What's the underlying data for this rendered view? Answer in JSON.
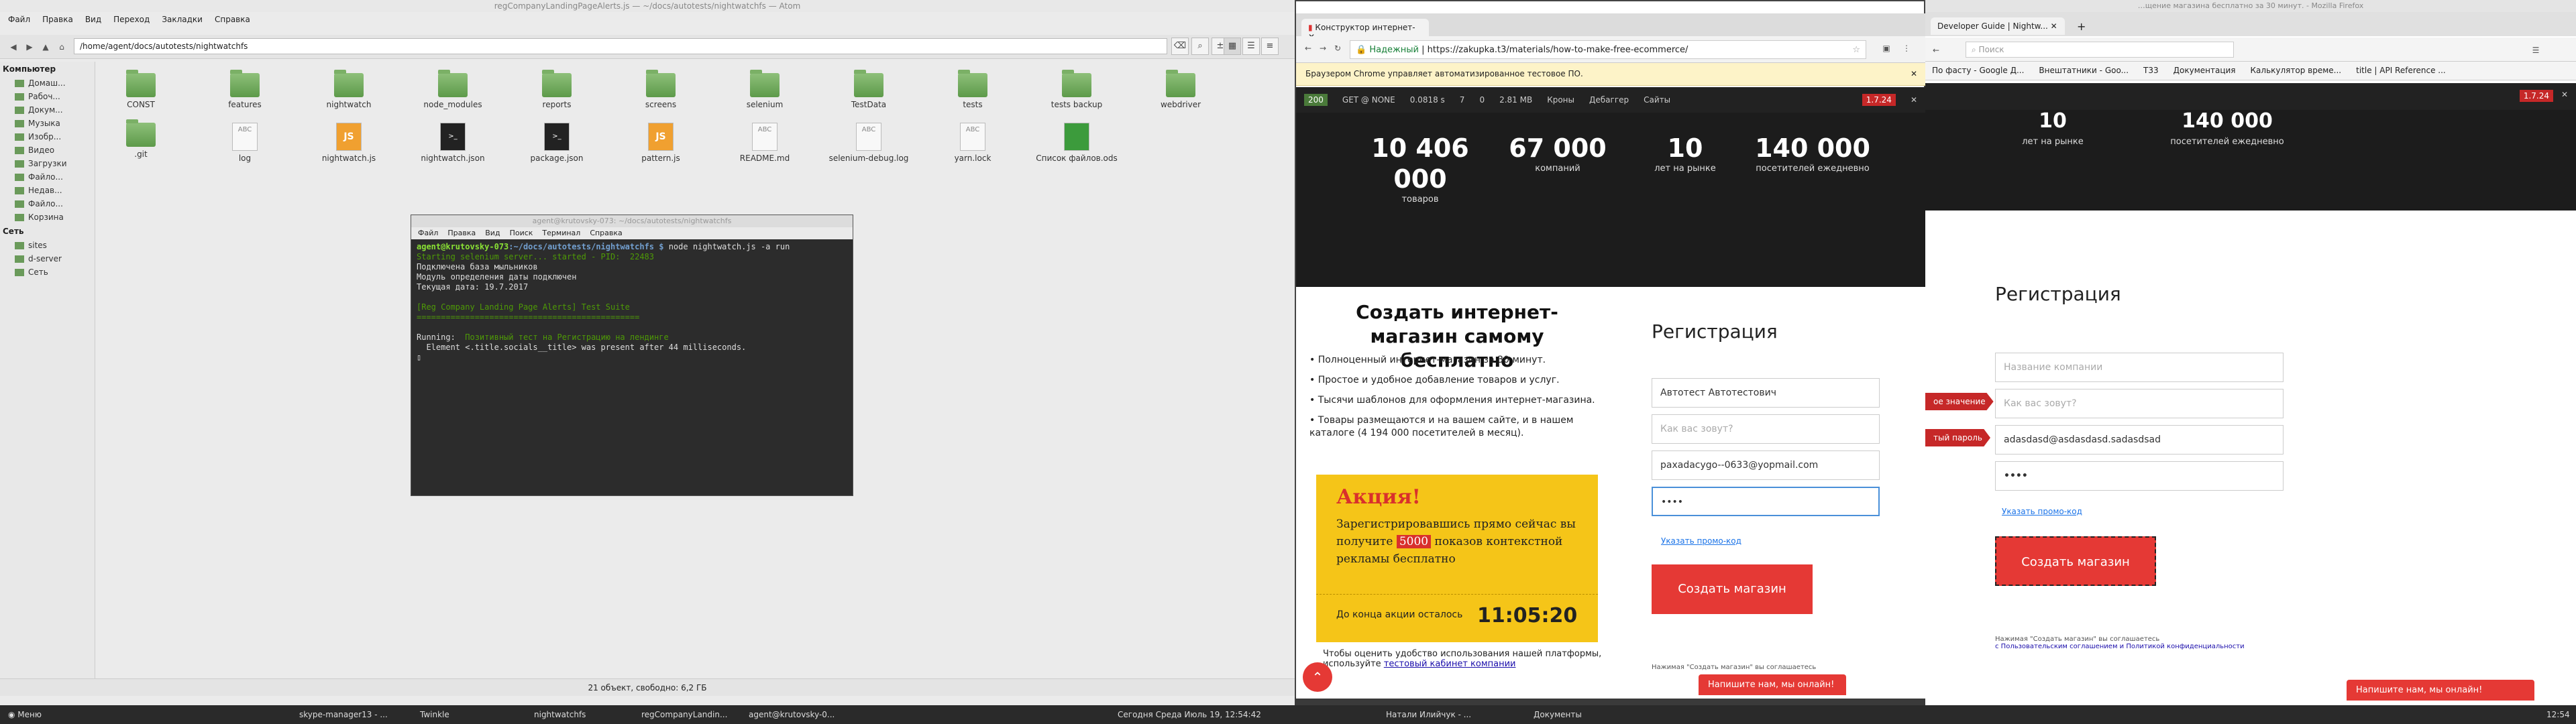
{
  "fm": {
    "title": "regCompanyLandingPageAlerts.js — ~/docs/autotests/nightwatchfs — Atom",
    "menu": [
      "Файл",
      "Правка",
      "Вид",
      "Переход",
      "Закладки",
      "Справка"
    ],
    "path": "/home/agent/docs/autotests/nightwatchfs",
    "sidebar": {
      "computer_head": "Компьютер",
      "computer": [
        "Домаш...",
        "Рабоч...",
        "Докум...",
        "Музыка",
        "Изобр...",
        "Видео",
        "Загрузки",
        "Файло...",
        "Недав...",
        "Файло...",
        "Корзина"
      ],
      "network_head": "Сеть",
      "network": [
        "sites",
        "d-server",
        "Сеть"
      ]
    },
    "folders": [
      "CONST",
      "features",
      "nightwatch",
      "node_modules",
      "reports",
      "screens",
      "selenium",
      "TestData",
      "tests",
      "tests backup",
      "webdriver"
    ],
    "files": [
      {
        "name": ".git",
        "kind": "folder"
      },
      {
        "name": "log",
        "kind": "doc"
      },
      {
        "name": "nightwatch.js",
        "kind": "js"
      },
      {
        "name": "nightwatch.json",
        "kind": "term"
      },
      {
        "name": "package.json",
        "kind": "term"
      },
      {
        "name": "pattern.js",
        "kind": "js"
      },
      {
        "name": "README.md",
        "kind": "doc"
      },
      {
        "name": "selenium-debug.log",
        "kind": "doc"
      },
      {
        "name": "yarn.lock",
        "kind": "doc"
      },
      {
        "name": "Список файлов.ods",
        "kind": "ods"
      }
    ],
    "status": "21 объект, свободно: 6,2 ГБ"
  },
  "terminal": {
    "title": "agent@krutovsky-073: ~/docs/autotests/nightwatchfs",
    "menu": [
      "Файл",
      "Правка",
      "Вид",
      "Поиск",
      "Терминал",
      "Справка"
    ],
    "prompt": "agent@krutovsky-073",
    "cwd": ":~/docs/autotests/nightwatchfs $",
    "cmd": " node nightwatch.js -a run",
    "l2": "Starting selenium server... started - PID:  22483",
    "l3": "Подключена база мыльников",
    "l4": "Модуль определения даты подключен",
    "l5": "Текущая дата: 19.7.2017",
    "l6": "[Reg Company Landing Page Alerts] Test Suite",
    "l7": "==============================================",
    "l8a": "Running:",
    "l8b": "  Позитивный тест на Регистрацию на лендинге",
    "l9": "  Element <.title.socials__title> was present after 44 milliseconds."
  },
  "chrome": {
    "tab": "Конструктор интернет-",
    "url_secure": "Надежный",
    "url": "https://zakupka.t3/materials/how-to-make-free-ecommerce/",
    "infobar": "Браузером Chrome управляет автоматизированное тестовое ПО.",
    "debug": [
      "200",
      "GET @ NONE",
      "0.0818 s",
      "7",
      "0",
      "2.81 MB",
      "Кроны",
      "Дебаггер",
      "Сайты",
      "1.7.24"
    ],
    "stats": [
      {
        "n": "10 406 000",
        "l": "товаров"
      },
      {
        "n": "67 000",
        "l": "компаний"
      },
      {
        "n": "10",
        "l": "лет на рынке"
      },
      {
        "n": "140 000",
        "l": "посетителей ежедневно"
      }
    ],
    "page_title": "Создать интернет-магазин самому бесплатно",
    "bullets": [
      "• Полноценный интернет-магазин за 30 минут.",
      "• Простое и удобное добавление товаров и услуг.",
      "• Тысячи шаблонов для оформления интернет-магазина.",
      "• Товары размещаются и на вашем сайте, и в нашем каталоге (4 194 000 посетителей в месяц)."
    ],
    "promo_h": "Акция!",
    "promo_t1": "Зарегистрировавшись прямо сейчас вы получите ",
    "promo_hl": "5000",
    "promo_t2": " показов контекстной рекламы бесплатно",
    "countdown_label": "До конца акции осталось",
    "countdown": "11:05:20",
    "note": "Чтобы оценить удобство использования нашей платформы, используйте ",
    "note_link": "тестовый кабинет компании",
    "reg_title": "Регистрация",
    "f_company": "Автотест Автотестович",
    "f_name_ph": "Как вас зовут?",
    "f_email": "paxadacygo--0633@yopmail.com",
    "f_pass": "••••",
    "promo_link": "Указать промо-код",
    "submit": "Создать магазин",
    "agree": "Нажимая \"Создать магазин\" вы соглашаетесь",
    "chat": "Напишите нам, мы онлайн!"
  },
  "firefox": {
    "title": "…щение магазина бесплатно за 30 минут. - Mozilla Firefox",
    "tab": "Developer Guide | Nightw...",
    "search_ph": "Поиск",
    "bookmarks": [
      "По фасту - Google Д...",
      "Внештатники - Goo...",
      "Т33",
      "Документация",
      "Калькулятор време...",
      "title | API Reference ..."
    ],
    "debug_ver": "1.7.24",
    "stats": [
      {
        "n": "10",
        "l": "лет на рынке"
      },
      {
        "n": "140 000",
        "l": "посетителей ежедневно"
      }
    ],
    "reg_title": "Регистрация",
    "f_company_ph": "Название компании",
    "f_name_ph": "Как вас зовут?",
    "f_email": "adasdasd@asdasdasd.sadasdsad",
    "f_pass": "••••",
    "tag1": "ое значение",
    "tag2": "тый пароль",
    "promo_link": "Указать промо-код",
    "submit": "Создать магазин",
    "agree1": "Нажимая \"Создать магазин\" вы соглашаетесь",
    "agree2": "с Пользовательским соглашением и Политикой конфиденциальности",
    "chat": "Напишите нам, мы онлайн!"
  },
  "taskbar": {
    "menu": "Меню",
    "items": [
      "skype-manager13 - ...",
      "Twinkle",
      "nightwatchfs",
      "regCompanyLandin...",
      "agent@krutovsky-0...",
      "Натали Илийчук - ...",
      "Документы"
    ],
    "clock": "Сегодня Среда Июль 19, 12:54:42",
    "time": "12:54"
  }
}
